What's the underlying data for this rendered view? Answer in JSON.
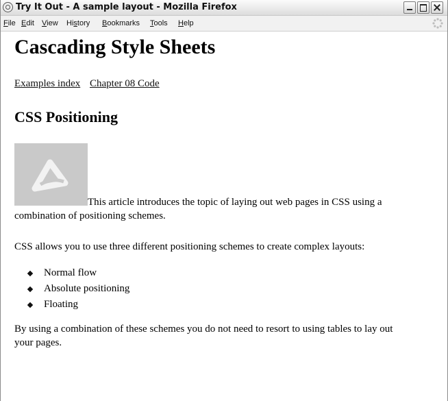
{
  "window": {
    "title": "Try It Out - A sample layout - Mozilla Firefox"
  },
  "menubar": {
    "items": [
      {
        "label": "File"
      },
      {
        "label": "Edit"
      },
      {
        "label": "View"
      },
      {
        "label": "History"
      },
      {
        "label": "Bookmarks"
      },
      {
        "label": "Tools"
      },
      {
        "label": "Help"
      }
    ]
  },
  "page": {
    "heading": "Cascading Style Sheets",
    "links": [
      "Examples index",
      "Chapter 08 Code"
    ],
    "subheading": "CSS Positioning",
    "intro_line1": "This article introduces the topic of laying out web pages in CSS using a",
    "intro_line2": "combination of positioning schemes.",
    "paragraph2": "CSS allows you to use three different positioning schemes to create complex layouts:",
    "bullets": [
      "Normal flow",
      "Absolute positioning",
      "Floating"
    ],
    "paragraph3_line1": "By using a combination of these schemes you do not need to resort to using tables to lay out",
    "paragraph3_line2": "your pages."
  },
  "icons": {
    "app": "firefox-globe-icon",
    "throbber": "throbber-icon",
    "thumbnail": "image-placeholder-icon"
  }
}
